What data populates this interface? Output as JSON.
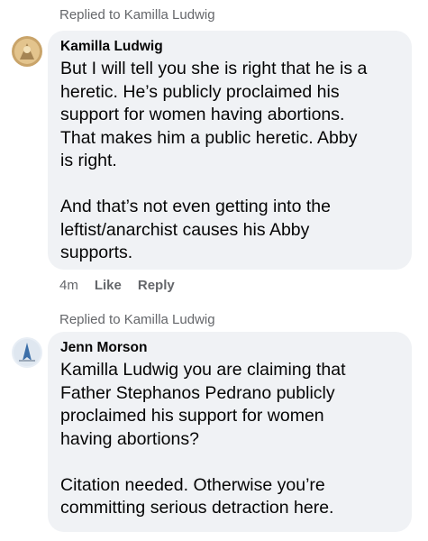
{
  "comments": [
    {
      "replied_to": "Replied to Kamilla Ludwig",
      "author": "Kamilla Ludwig",
      "text": "But I will tell you she is right that he is a\nheretic. He’s publicly proclaimed his\nsupport for women having abortions.\nThat makes him a public heretic. Abby\nis right.\n\nAnd that’s not even getting into the\nleftist/anarchist causes his Abby\nsupports.",
      "time": "4m",
      "like": "Like",
      "reply": "Reply"
    },
    {
      "replied_to": "Replied to Kamilla Ludwig",
      "author": "Jenn Morson",
      "text": "Kamilla Ludwig you are claiming that\nFather Stephanos Pedrano publicly\nproclaimed his support for women\nhaving abortions?\n\nCitation needed. Otherwise you’re\ncommitting serious detraction here."
    }
  ]
}
